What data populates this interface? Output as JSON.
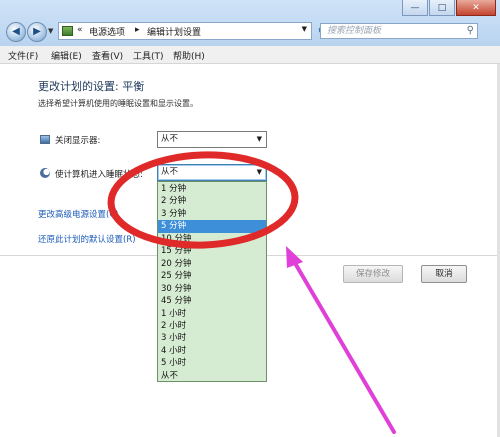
{
  "window": {
    "address": {
      "prefix": "«",
      "crumb1": "电源选项",
      "sep": "▸",
      "crumb2": "编辑计划设置"
    },
    "search_placeholder": "搜索控制面板",
    "controls": {
      "minimize": "—",
      "maximize": "□",
      "close": "✕"
    }
  },
  "menu": {
    "file": "文件(F)",
    "edit": "编辑(E)",
    "view": "查看(V)",
    "tools": "工具(T)",
    "help": "帮助(H)"
  },
  "content": {
    "title": "更改计划的设置: 平衡",
    "description": "选择希望计算机使用的睡眠设置和显示设置。",
    "display_label": "关闭显示器:",
    "display_value": "从不",
    "sleep_label": "使计算机进入睡眠状态:",
    "sleep_value": "从不",
    "advanced_link": "更改高级电源设置(C)",
    "restore_link": "还原此计划的默认设置(R)",
    "save_button": "保存修改",
    "cancel_button": "取消"
  },
  "sleep_options": [
    "1 分钟",
    "2 分钟",
    "3 分钟",
    "5 分钟",
    "10 分钟",
    "15 分钟",
    "20 分钟",
    "25 分钟",
    "30 分钟",
    "45 分钟",
    "1 小时",
    "2 小时",
    "3 小时",
    "4 小时",
    "5 小时",
    "从不"
  ],
  "selected_option": "5 分钟",
  "annotation_colors": {
    "circle": "#e02a2a",
    "arrow": "#e040d8"
  }
}
